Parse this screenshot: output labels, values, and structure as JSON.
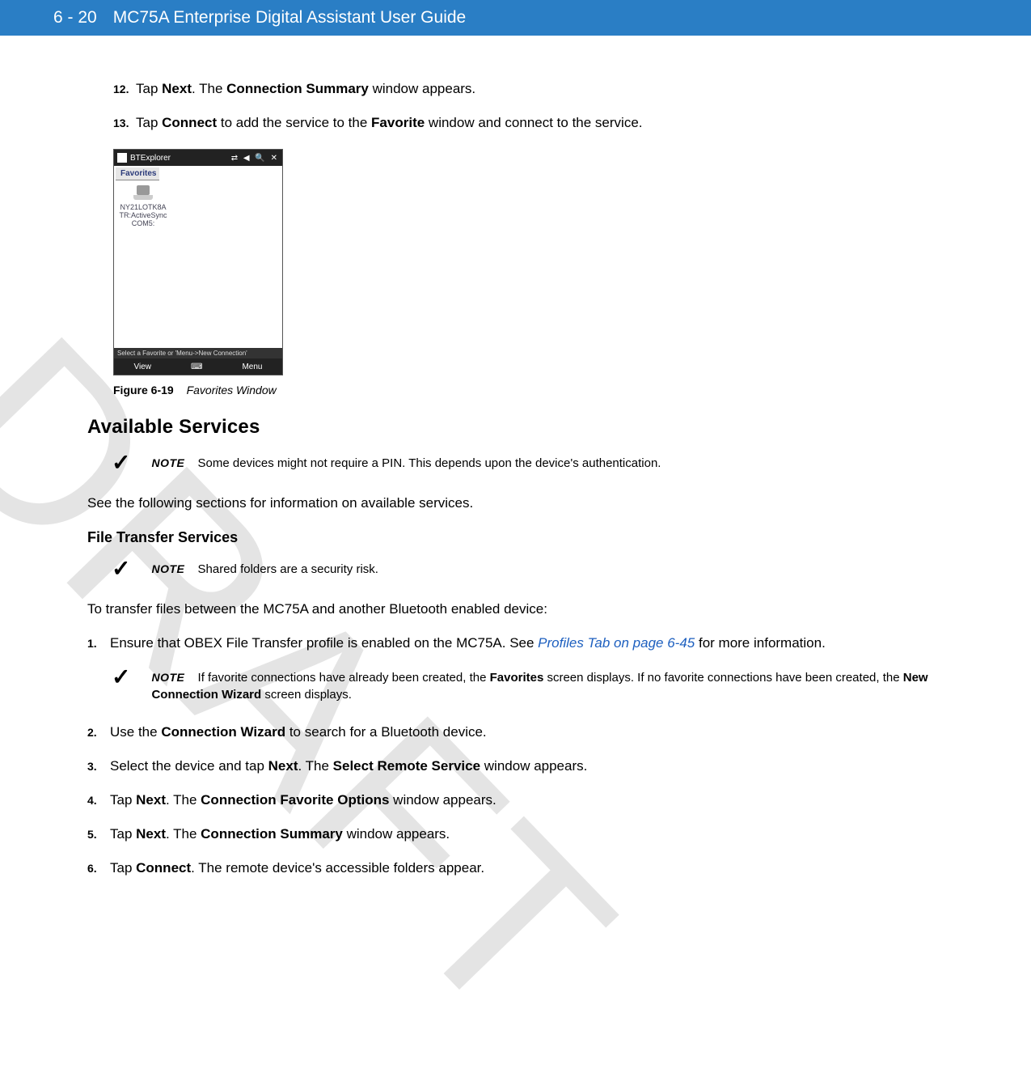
{
  "header": {
    "page_number": "6 - 20",
    "title": "MC75A Enterprise Digital Assistant User Guide"
  },
  "watermark": "DRAFT",
  "steps_top": [
    {
      "num": "12.",
      "pre": "Tap ",
      "b1": "Next",
      "mid": ". The ",
      "b2": "Connection Summary",
      "post": " window appears."
    },
    {
      "num": "13.",
      "pre": "Tap ",
      "b1": "Connect",
      "mid": " to add the service to the ",
      "b2": "Favorite",
      "post": " window and connect to the service."
    }
  ],
  "screenshot": {
    "title": "BTExplorer",
    "top_icons": "⇄ ◀ 🔍 ✕",
    "tab": "Favorites",
    "item_line1": "NY21LOTK8A",
    "item_line2": "TR:ActiveSync",
    "item_line3": "COM5:",
    "status": "Select a Favorite or 'Menu->New Connection'",
    "bottom_left": "View",
    "bottom_right": "Menu"
  },
  "figure": {
    "label": "Figure 6-19",
    "title": "Favorites Window"
  },
  "section_h2": "Available Services",
  "note1": {
    "label": "NOTE",
    "text": "Some devices might not require a PIN. This depends upon the device's authentication."
  },
  "para1": "See the following sections for information on available services.",
  "subsection_h3": "File Transfer Services",
  "note2": {
    "label": "NOTE",
    "text": "Shared folders are a security risk."
  },
  "para2": "To transfer files between the MC75A and another Bluetooth enabled device:",
  "step1": {
    "num": "1.",
    "pre": "Ensure that OBEX File Transfer profile is enabled on the MC75A. See ",
    "link": "Profiles Tab on page 6-45",
    "post": " for more information."
  },
  "note3": {
    "label": "NOTE",
    "pre": "If favorite connections have already been created, the ",
    "b1": "Favorites",
    "mid": " screen displays. If no favorite connections have been created, the ",
    "b2": "New Connection Wizard",
    "post": " screen displays."
  },
  "steps_sub": [
    {
      "num": "2.",
      "pre": "Use the ",
      "b1": "Connection Wizard",
      "post": " to search for a Bluetooth device."
    },
    {
      "num": "3.",
      "pre": "Select the device and tap ",
      "b1": "Next",
      "mid": ". The ",
      "b2": "Select Remote Service",
      "post": " window appears."
    },
    {
      "num": "4.",
      "pre": "Tap ",
      "b1": "Next",
      "mid": ". The ",
      "b2": "Connection Favorite Options",
      "post": " window appears."
    },
    {
      "num": "5.",
      "pre": "Tap ",
      "b1": "Next",
      "mid": ". The ",
      "b2": "Connection Summary",
      "post": " window appears."
    },
    {
      "num": "6.",
      "pre": "Tap ",
      "b1": "Connect",
      "post": ". The remote device's accessible folders appear."
    }
  ]
}
